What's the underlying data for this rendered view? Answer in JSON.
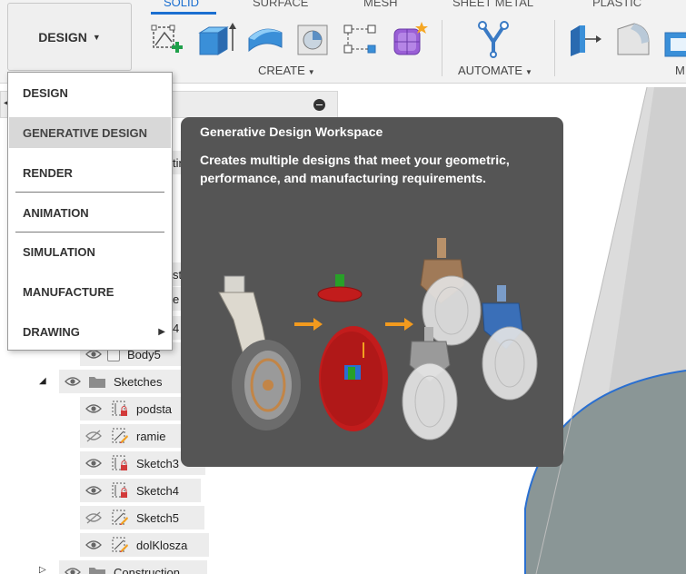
{
  "toolbar": {
    "workspace_button": "DESIGN",
    "tabs": [
      "SOLID",
      "SURFACE",
      "MESH",
      "SHEET METAL",
      "PLASTIC"
    ],
    "groups": {
      "create": "CREATE",
      "automate": "AUTOMATE",
      "modify_partial": "M"
    },
    "accent_color": "#1b6fd0"
  },
  "workspace_menu": {
    "items": [
      {
        "label": "DESIGN"
      },
      {
        "label": "GENERATIVE DESIGN",
        "state": "hover"
      },
      {
        "label": "RENDER"
      },
      {
        "label": "ANIMATION"
      },
      {
        "label": "SIMULATION"
      },
      {
        "label": "MANUFACTURE"
      },
      {
        "label": "DRAWING",
        "submenu": true
      }
    ]
  },
  "tooltip": {
    "title": "Generative Design Workspace",
    "description": "Creates multiple designs that meet your geometric, performance, and manufacturing requirements."
  },
  "browser": {
    "partial_labels": [
      "tin",
      "sta",
      "e",
      "4"
    ],
    "body_item": "Body5",
    "sketches_folder": "Sketches",
    "sketches": [
      {
        "label": "podsta",
        "visible": true,
        "icon": "sketch-locked-icon"
      },
      {
        "label": "ramie",
        "visible": false,
        "icon": "sketch-edit-icon"
      },
      {
        "label": "Sketch3",
        "visible": true,
        "icon": "sketch-locked-icon"
      },
      {
        "label": "Sketch4",
        "visible": true,
        "icon": "sketch-locked-icon"
      },
      {
        "label": "Sketch5",
        "visible": false,
        "icon": "sketch-edit-icon"
      },
      {
        "label": "dolKlosza",
        "visible": true,
        "icon": "sketch-edit-icon"
      }
    ],
    "construction_folder": "Construction"
  }
}
